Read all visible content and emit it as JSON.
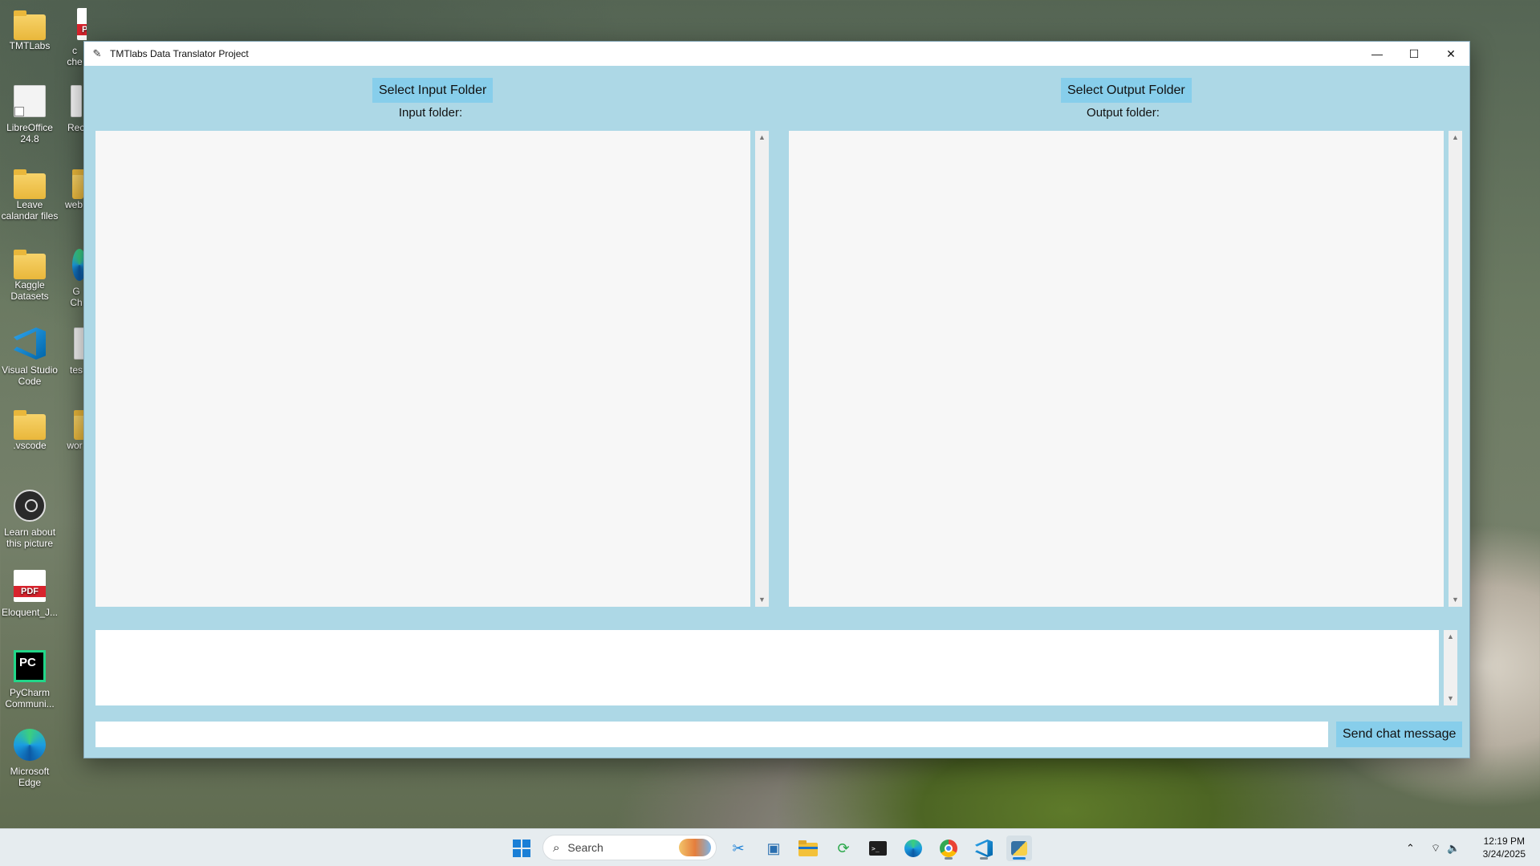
{
  "desktop": {
    "icons": [
      {
        "label": "TMTLabs"
      },
      {
        "label": "LibreOffice 24.8"
      },
      {
        "label": "Leave calandar files"
      },
      {
        "label": "Kaggle Datasets"
      },
      {
        "label": "Visual Studio Code"
      },
      {
        "label": ".vscode"
      },
      {
        "label": "Learn about this picture"
      },
      {
        "label": "Eloquent_J..."
      },
      {
        "label": "PyCharm Communi..."
      },
      {
        "label": "Microsoft Edge"
      }
    ],
    "partial_icons": [
      {
        "label": "c\nche"
      },
      {
        "label": "Rec"
      },
      {
        "label": "web"
      },
      {
        "label": "G\nCh"
      },
      {
        "label": "tes"
      },
      {
        "label": "wor"
      }
    ]
  },
  "window": {
    "title": "TMTlabs Data Translator Project",
    "controls": {
      "minimize": "—",
      "maximize": "☐",
      "close": "✕"
    },
    "select_input_label": "Select Input Folder",
    "input_folder_label": "Input folder:",
    "select_output_label": "Select Output Folder",
    "output_folder_label": "Output folder:",
    "input_text": "",
    "output_text": "",
    "chat_log": "",
    "chat_input_value": "",
    "send_label": "Send chat message",
    "colors": {
      "background": "#add8e6",
      "button": "#87ceeb"
    }
  },
  "taskbar": {
    "search_placeholder": "Search",
    "icons": [
      "windows-start",
      "snipping-tool",
      "remote-desktop",
      "file-explorer",
      "refresh-app",
      "terminal",
      "edge",
      "chrome",
      "vscode",
      "python-app"
    ],
    "time": "12:19 PM",
    "date": "3/24/2025"
  }
}
